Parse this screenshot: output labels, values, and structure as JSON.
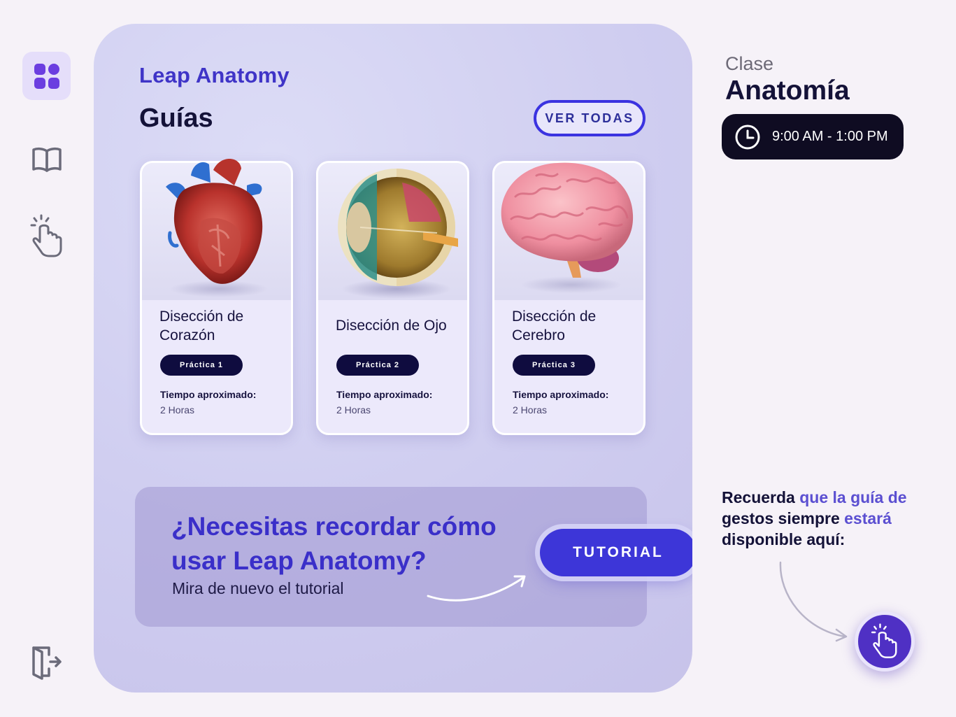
{
  "brand": "Leap Anatomy",
  "section_title": "Guías",
  "see_all_label": "VER TODAS",
  "guides": [
    {
      "title": "Disección de Corazón",
      "badge": "Práctica 1",
      "time_label": "Tiempo aproximado:",
      "time_value": "2 Horas",
      "image": "heart"
    },
    {
      "title": "Disección de Ojo",
      "badge": "Práctica 2",
      "time_label": "Tiempo aproximado:",
      "time_value": "2 Horas",
      "image": "eye"
    },
    {
      "title": "Disección de Cerebro",
      "badge": "Práctica 3",
      "time_label": "Tiempo aproximado:",
      "time_value": "2 Horas",
      "image": "brain"
    }
  ],
  "banner": {
    "question": "¿Necesitas recordar cómo usar Leap Anatomy?",
    "subtitle": "Mira de nuevo el tutorial",
    "button_label": "TUTORIAL"
  },
  "class_info": {
    "label": "Clase",
    "name": "Anatomía",
    "schedule": "9:00 AM - 1:00 PM"
  },
  "reminder": {
    "part1": "Recuerda",
    "part2": " que ",
    "part3": "la guía de",
    "part4": " gestos siempre ",
    "part5": "estará",
    "part6": " disponible aquí:"
  },
  "sidebar_icons": [
    "apps-grid-icon",
    "book-icon",
    "gesture-hand-icon",
    "exit-icon"
  ],
  "colors": {
    "accent": "#3d36d8",
    "brand": "#3f34c7",
    "dark": "#0f0c3f",
    "fab": "#4f30c4"
  }
}
